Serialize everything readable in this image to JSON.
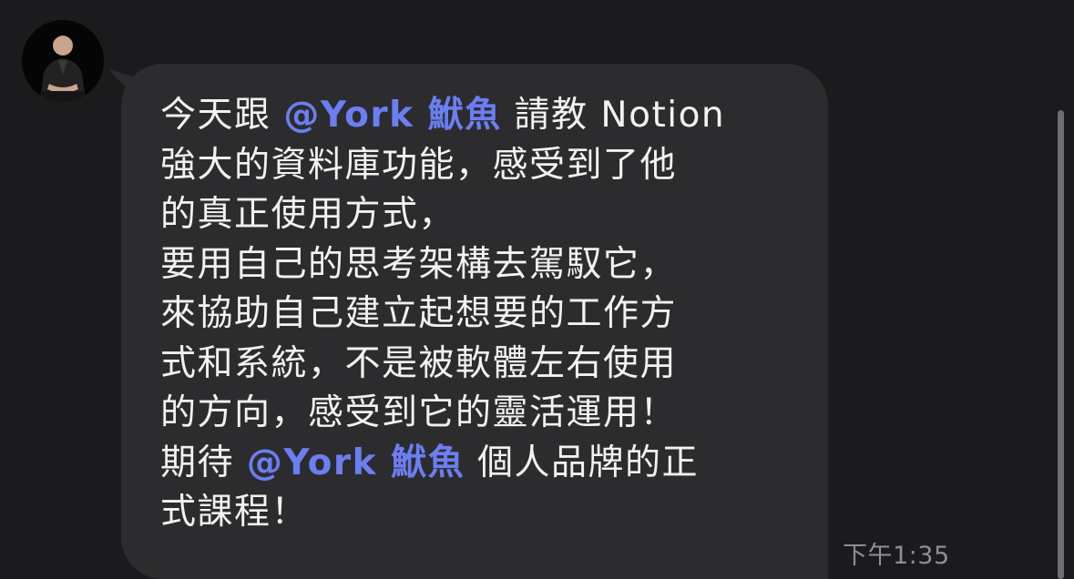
{
  "sender": {
    "avatar_icon": "person-avatar-icon"
  },
  "message": {
    "line1": {
      "a": "今天跟 ",
      "mention": "@York 鮲魚",
      "b": "  請教 Notion"
    },
    "line2": "強大的資料庫功能，感受到了他",
    "line3": "的真正使用方式，",
    "line4": "要用自己的思考架構去駕馭它，",
    "line5": "來協助自己建立起想要的工作方",
    "line6": "式和系統，不是被軟體左右使用",
    "line7": "的方向，感受到它的靈活運用！",
    "line8": {
      "a": "期待 ",
      "mention": "@York 鮲魚",
      "b": " 個人品牌的正"
    },
    "line9": "式課程！",
    "timestamp": "下午1:35"
  },
  "colors": {
    "background": "#1b1b1d",
    "bubble": "#2c2c2e",
    "text": "#f2f2f2",
    "mention": "#6b7ef2",
    "timestamp": "#8e8e93"
  }
}
